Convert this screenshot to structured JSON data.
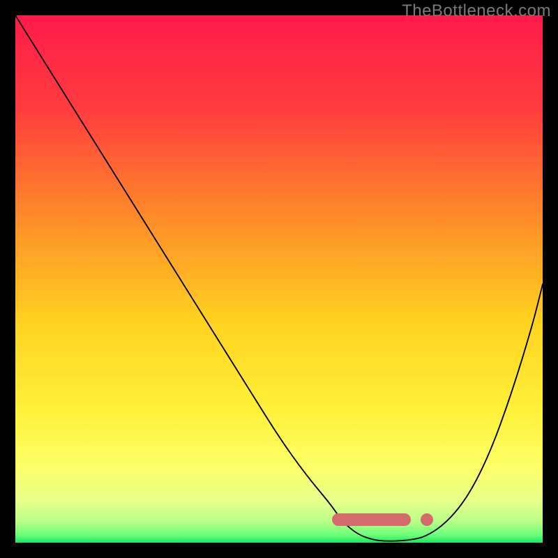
{
  "watermark": "TheBottleneck.com",
  "chart_data": {
    "type": "line",
    "title": "",
    "xlabel": "",
    "ylabel": "",
    "xlim": [
      0,
      100
    ],
    "ylim": [
      0,
      100
    ],
    "series": [
      {
        "name": "bottleneck-curve",
        "x": [
          0,
          5,
          10,
          15,
          20,
          25,
          30,
          35,
          40,
          45,
          50,
          55,
          60,
          62,
          65,
          68,
          70,
          72,
          75,
          78,
          82,
          86,
          90,
          94,
          98,
          100
        ],
        "y": [
          100,
          92,
          84,
          76,
          68,
          60,
          52,
          44,
          36,
          28,
          20,
          13,
          7,
          4,
          1.5,
          0.5,
          0.3,
          0.3,
          0.5,
          1.2,
          4,
          9,
          17,
          28,
          41,
          49
        ]
      }
    ],
    "optimal_range": {
      "start_pct": 60,
      "end_pct": 75,
      "dot_pct": 78
    },
    "gradient_stops": [
      {
        "pct": 0,
        "color": "#ff1a4b"
      },
      {
        "pct": 18,
        "color": "#ff3d3d"
      },
      {
        "pct": 38,
        "color": "#ff8a2a"
      },
      {
        "pct": 58,
        "color": "#ffd21f"
      },
      {
        "pct": 75,
        "color": "#fff13a"
      },
      {
        "pct": 86,
        "color": "#fdff6a"
      },
      {
        "pct": 92,
        "color": "#e8ff8a"
      },
      {
        "pct": 96,
        "color": "#b8ff8a"
      },
      {
        "pct": 98.5,
        "color": "#6cff7a"
      },
      {
        "pct": 100,
        "color": "#18e85e"
      }
    ]
  }
}
